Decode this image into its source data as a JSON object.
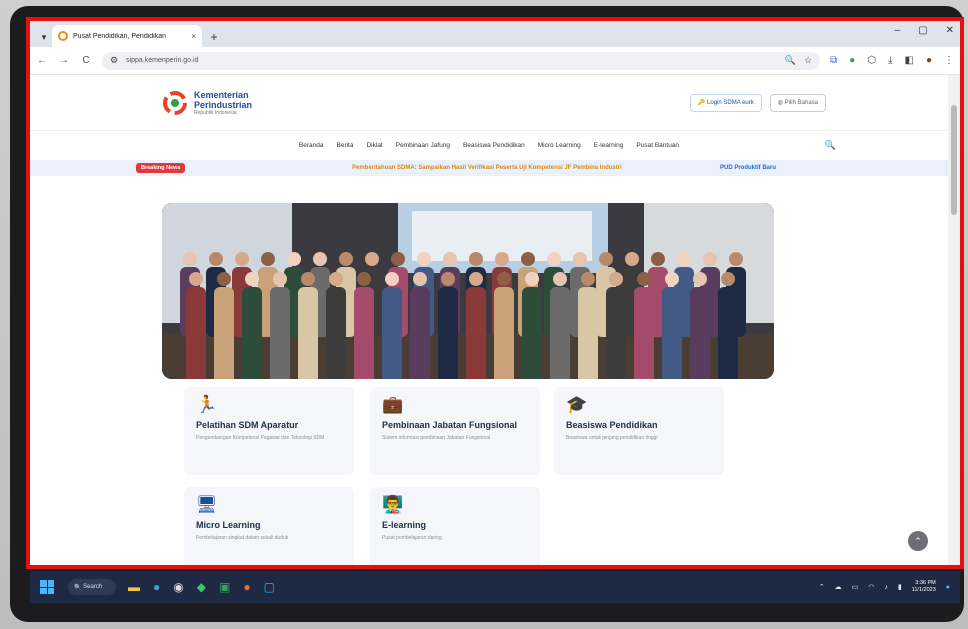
{
  "browser": {
    "tab_title": "Pusat Pendidikan, Pendidikan",
    "tab_close": "×",
    "new_tab": "+",
    "window_controls": [
      "–",
      "▢",
      "✕"
    ],
    "url": "sippa.kemenperin.go.id",
    "nav": {
      "back": "←",
      "forward": "→",
      "reload": "C"
    }
  },
  "site": {
    "logo_name_line1": "Kementerian",
    "logo_name_line2": "Perindustrian",
    "logo_sub": "Republik Indonesia",
    "login_label": "Login SDMA eurk",
    "lang_label": "Pilih Bahasa",
    "menu": [
      "Beranda",
      "Berita",
      "Diklat",
      "Pembinaan Jafung",
      "Beasiswa Pendidikan",
      "Micro Learning",
      "E-learning",
      "Pusat Bantuan"
    ],
    "ticker_badge": "Breaking News",
    "ticker_text": "Pemberitahuan SDMA: Sampaikan Hasil Verifikasi Peserta Uji Kompetensi JF Pembina Industri",
    "ticker_text2": "PUD Produktif Baru"
  },
  "cards": [
    {
      "icon": "running-icon",
      "glyph": "🏃",
      "title": "Pelatihan SDM Aparatur",
      "desc": "Pengembangan Kompetensi Pegawai dan Teknologi SDM"
    },
    {
      "icon": "briefcase-icon",
      "glyph": "💼",
      "title": "Pembinaan Jabatan Fungsional",
      "desc": "Sistem informasi pembinaan Jabatan Fungsional"
    },
    {
      "icon": "graduation-cap-icon",
      "glyph": "🎓",
      "title": "Beasiswa Pendidikan",
      "desc": "Beasiswa untuk jenjang pendidikan tinggi"
    },
    {
      "icon": "monitor-icon",
      "glyph": "🖥",
      "title": "Micro Learning",
      "desc": "Pembelajaran singkat dalam sekali duduk"
    },
    {
      "icon": "presentation-icon",
      "glyph": "👨‍🏫",
      "title": "E-learning",
      "desc": "Pusat pembelajaran daring"
    }
  ],
  "taskbar": {
    "search_label": "Search",
    "time": "3:36 PM",
    "date": "11/1/2023"
  },
  "colors": {
    "accent": "#1d4e9e",
    "ticker_badge": "#e03a3a",
    "highlight": "#e3100f"
  }
}
